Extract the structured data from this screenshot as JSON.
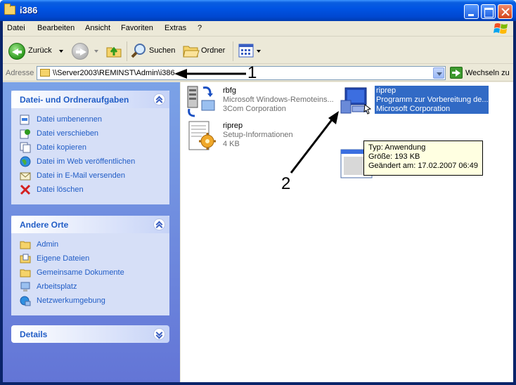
{
  "window": {
    "title": "i386"
  },
  "menu": [
    "Datei",
    "Bearbeiten",
    "Ansicht",
    "Favoriten",
    "Extras",
    "?"
  ],
  "toolbar": {
    "back_label": "Zurück",
    "search_label": "Suchen",
    "folders_label": "Ordner"
  },
  "address": {
    "label": "Adresse",
    "path": "\\\\Server2003\\REMINST\\Admin\\i386",
    "go_label": "Wechseln zu"
  },
  "taskpane": {
    "file_tasks": {
      "title": "Datei- und Ordneraufgaben",
      "items": [
        {
          "label": "Datei umbenennen",
          "icon": "rename-icon"
        },
        {
          "label": "Datei verschieben",
          "icon": "move-icon"
        },
        {
          "label": "Datei kopieren",
          "icon": "copy-icon"
        },
        {
          "label": "Datei im Web veröffentlichen",
          "icon": "web-publish-icon"
        },
        {
          "label": "Datei in E-Mail versenden",
          "icon": "email-icon"
        },
        {
          "label": "Datei löschen",
          "icon": "delete-icon"
        }
      ]
    },
    "other_places": {
      "title": "Andere Orte",
      "items": [
        {
          "label": "Admin",
          "icon": "folder-icon"
        },
        {
          "label": "Eigene Dateien",
          "icon": "my-documents-icon"
        },
        {
          "label": "Gemeinsame Dokumente",
          "icon": "folder-icon"
        },
        {
          "label": "Arbeitsplatz",
          "icon": "my-computer-icon"
        },
        {
          "label": "Netzwerkumgebung",
          "icon": "network-icon"
        }
      ]
    },
    "details": {
      "title": "Details"
    }
  },
  "files": [
    {
      "name": "rbfg",
      "line2": "Microsoft Windows-Remoteins...",
      "line3": "3Com Corporation",
      "icon": "server-app-icon"
    },
    {
      "name": "riprep",
      "line2": "Programm zur Vorbereitung de...",
      "line3": "Microsoft Corporation",
      "icon": "computer-app-icon",
      "selected": true
    },
    {
      "name": "riprep",
      "line2": "Setup-Informationen",
      "line3": "4 KB",
      "icon": "setup-info-icon"
    },
    {
      "name": "",
      "icon": "window-icon"
    }
  ],
  "tooltip": {
    "type": "Typ: Anwendung",
    "size": "Größe: 193 KB",
    "modified": "Geändert am: 17.02.2007 06:49"
  },
  "annotations": {
    "one": "1",
    "two": "2"
  },
  "colors": {
    "title_bar": "#0054e3",
    "task_pane": "#6f8fe0",
    "selection": "#316ac5",
    "tooltip_bg": "#ffffe1",
    "link": "#215dc6"
  }
}
